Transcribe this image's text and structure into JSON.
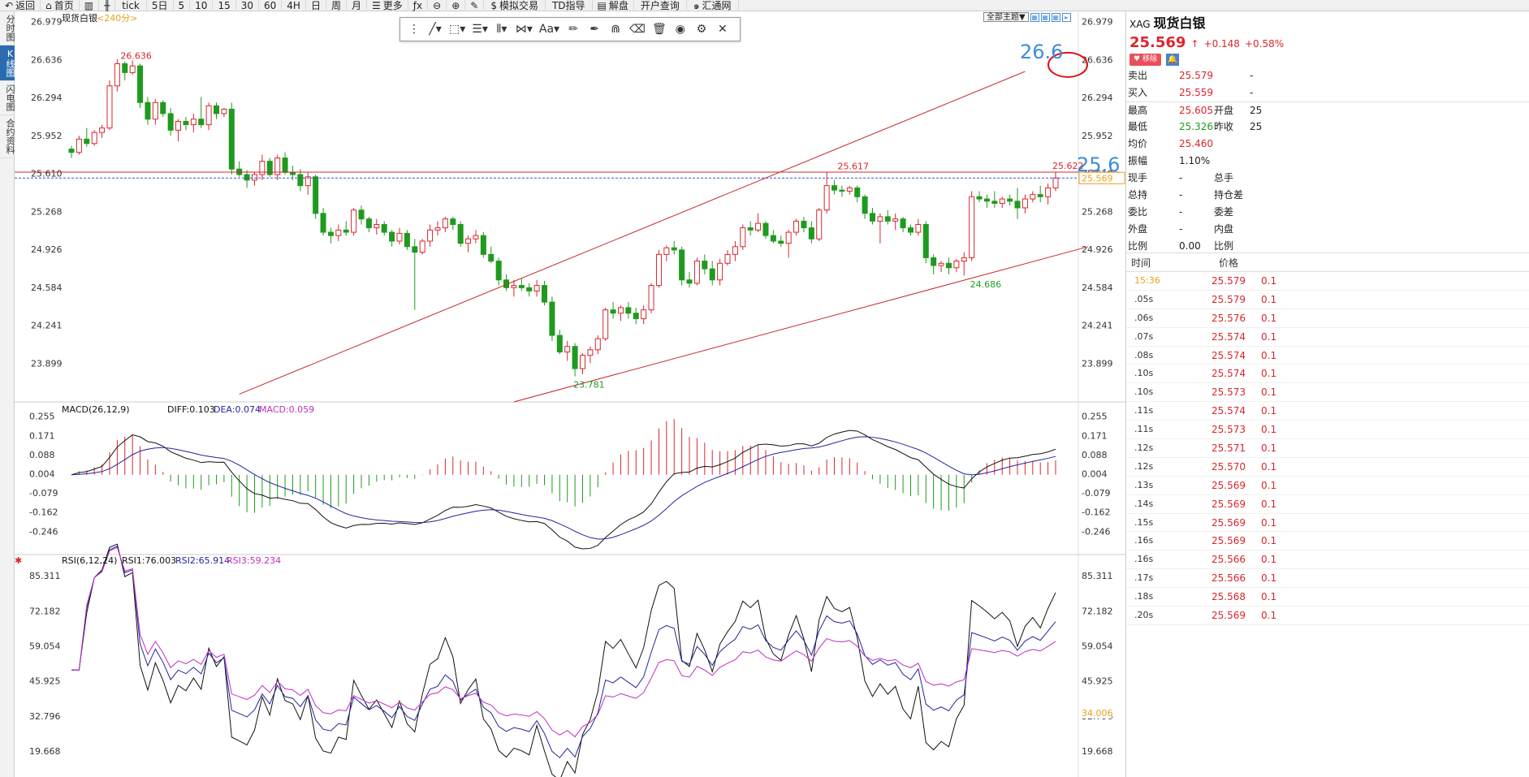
{
  "toolbar": [
    {
      "id": "back",
      "icon": "back-arrow-icon",
      "label": "返回"
    },
    {
      "id": "home",
      "icon": "home-icon",
      "label": "首页"
    },
    {
      "id": "chart-type",
      "icon": "bar-chart-icon",
      "label": ""
    },
    {
      "id": "candle-type",
      "icon": "candlestick-icon",
      "label": ""
    },
    {
      "id": "tick",
      "label": "tick"
    },
    {
      "id": "5d",
      "label": "5日"
    },
    {
      "id": "5m",
      "label": "5"
    },
    {
      "id": "10m",
      "label": "10"
    },
    {
      "id": "15m",
      "label": "15"
    },
    {
      "id": "30m",
      "label": "30"
    },
    {
      "id": "60m",
      "label": "60"
    },
    {
      "id": "4h",
      "label": "4H"
    },
    {
      "id": "day",
      "label": "日"
    },
    {
      "id": "week",
      "label": "周"
    },
    {
      "id": "month",
      "label": "月"
    },
    {
      "id": "more",
      "icon": "list-icon",
      "label": "更多"
    },
    {
      "id": "fx",
      "icon": "fx-icon",
      "label": ""
    },
    {
      "id": "zoom-out",
      "icon": "zoom-out-icon",
      "label": ""
    },
    {
      "id": "zoom-in",
      "icon": "zoom-in-icon",
      "label": ""
    },
    {
      "id": "draw",
      "icon": "pen-icon",
      "label": ""
    },
    {
      "id": "sim",
      "icon": "dollar-icon",
      "label": "模拟交易"
    },
    {
      "id": "td",
      "label": "TD指导"
    },
    {
      "id": "jiepan",
      "icon": "book-icon",
      "label": "解盘"
    },
    {
      "id": "account",
      "label": "开户查询"
    },
    {
      "id": "huitong",
      "icon": "swirl-icon",
      "label": "汇通网"
    }
  ],
  "left_tabs": [
    {
      "label": "分时图",
      "active": false
    },
    {
      "label": "K线图",
      "active": true
    },
    {
      "label": "闪电图",
      "active": false
    },
    {
      "label": "合约资料",
      "active": false
    }
  ],
  "draw_tools": [
    "line-tool-icon",
    "shape-tool-icon",
    "fib-tool-icon",
    "channel-tool-icon",
    "pattern-tool-icon",
    "text-tool-icon",
    "ruler-icon",
    "brush-icon",
    "magnet-icon",
    "eraser-icon",
    "trash-icon",
    "eye-icon",
    "settings-icon",
    "close-icon"
  ],
  "draw_tool_text": "Aa",
  "theme": {
    "label": "全部主题▼"
  },
  "chart": {
    "title": "现货白银",
    "period": "<240分>",
    "yticks": [
      "26.979",
      "26.636",
      "26.294",
      "25.952",
      "25.610",
      "25.268",
      "24.926",
      "24.584",
      "24.241",
      "23.899"
    ],
    "current_price": "25.569",
    "annotations": {
      "high": "26.636",
      "low": "23.781",
      "mid_high": "25.617",
      "right_high": "25.622",
      "right_low": "24.686"
    },
    "big_labels": {
      "upper": "26.6",
      "level": "25.6"
    },
    "candles": [
      [
        25.83,
        25.86,
        25.75,
        25.8
      ],
      [
        25.8,
        25.95,
        25.78,
        25.92
      ],
      [
        25.92,
        26.02,
        25.85,
        25.88
      ],
      [
        25.88,
        26.0,
        25.86,
        25.98
      ],
      [
        25.98,
        26.05,
        25.93,
        26.02
      ],
      [
        26.02,
        26.45,
        26.0,
        26.4
      ],
      [
        26.4,
        26.64,
        26.35,
        26.6
      ],
      [
        26.6,
        26.62,
        26.45,
        26.52
      ],
      [
        26.52,
        26.63,
        26.5,
        26.58
      ],
      [
        26.58,
        26.6,
        26.2,
        26.25
      ],
      [
        26.25,
        26.3,
        26.05,
        26.1
      ],
      [
        26.1,
        26.28,
        26.05,
        26.25
      ],
      [
        26.25,
        26.27,
        26.12,
        26.15
      ],
      [
        26.15,
        26.2,
        25.95,
        26.0
      ],
      [
        26.0,
        26.1,
        25.9,
        26.08
      ],
      [
        26.08,
        26.12,
        26.0,
        26.05
      ],
      [
        26.05,
        26.15,
        25.98,
        26.1
      ],
      [
        26.1,
        26.3,
        26.02,
        26.05
      ],
      [
        26.05,
        26.25,
        26.0,
        26.22
      ],
      [
        26.22,
        26.25,
        26.1,
        26.15
      ],
      [
        26.15,
        26.2,
        26.12,
        26.19
      ],
      [
        26.19,
        26.25,
        25.6,
        25.65
      ],
      [
        25.65,
        25.72,
        25.58,
        25.6
      ],
      [
        25.6,
        25.64,
        25.48,
        25.55
      ],
      [
        25.55,
        25.62,
        25.5,
        25.6
      ],
      [
        25.6,
        25.78,
        25.55,
        25.72
      ],
      [
        25.72,
        25.75,
        25.58,
        25.6
      ],
      [
        25.6,
        25.78,
        25.55,
        25.75
      ],
      [
        25.75,
        25.8,
        25.6,
        25.62
      ],
      [
        25.62,
        25.68,
        25.55,
        25.6
      ],
      [
        25.6,
        25.65,
        25.45,
        25.5
      ],
      [
        25.5,
        25.62,
        25.42,
        25.58
      ],
      [
        25.58,
        25.6,
        25.2,
        25.25
      ],
      [
        25.25,
        25.3,
        25.05,
        25.08
      ],
      [
        25.08,
        25.12,
        24.98,
        25.05
      ],
      [
        25.05,
        25.15,
        25.0,
        25.1
      ],
      [
        25.1,
        25.18,
        25.05,
        25.08
      ],
      [
        25.08,
        25.3,
        25.05,
        25.28
      ],
      [
        25.28,
        25.32,
        25.15,
        25.2
      ],
      [
        25.2,
        25.22,
        25.08,
        25.12
      ],
      [
        25.12,
        25.2,
        25.06,
        25.15
      ],
      [
        25.15,
        25.18,
        25.05,
        25.08
      ],
      [
        25.08,
        25.1,
        24.95,
        25.0
      ],
      [
        25.0,
        25.12,
        24.97,
        25.07
      ],
      [
        25.07,
        25.1,
        24.92,
        24.95
      ],
      [
        24.95,
        25.02,
        24.38,
        24.9
      ],
      [
        24.9,
        25.02,
        24.88,
        25.0
      ],
      [
        25.0,
        25.15,
        24.95,
        25.1
      ],
      [
        25.1,
        25.18,
        25.05,
        25.12
      ],
      [
        25.12,
        25.22,
        25.08,
        25.2
      ],
      [
        25.2,
        25.22,
        25.1,
        25.15
      ],
      [
        25.15,
        25.18,
        24.95,
        24.98
      ],
      [
        24.98,
        25.05,
        24.9,
        25.02
      ],
      [
        25.02,
        25.1,
        24.98,
        25.05
      ],
      [
        25.05,
        25.08,
        24.85,
        24.88
      ],
      [
        24.88,
        24.95,
        24.8,
        24.82
      ],
      [
        24.82,
        24.85,
        24.6,
        24.65
      ],
      [
        24.65,
        24.7,
        24.55,
        24.58
      ],
      [
        24.58,
        24.65,
        24.5,
        24.6
      ],
      [
        24.6,
        24.66,
        24.55,
        24.58
      ],
      [
        24.58,
        24.62,
        24.5,
        24.55
      ],
      [
        24.55,
        24.65,
        24.5,
        24.6
      ],
      [
        24.6,
        24.64,
        24.42,
        24.45
      ],
      [
        24.45,
        24.5,
        24.1,
        24.15
      ],
      [
        24.15,
        24.2,
        23.98,
        24.0
      ],
      [
        24.0,
        24.1,
        23.92,
        24.05
      ],
      [
        24.05,
        24.08,
        23.78,
        23.85
      ],
      [
        23.85,
        23.99,
        23.8,
        23.97
      ],
      [
        23.97,
        24.05,
        23.9,
        24.02
      ],
      [
        24.02,
        24.15,
        23.98,
        24.12
      ],
      [
        24.12,
        24.4,
        24.1,
        24.38
      ],
      [
        24.38,
        24.45,
        24.3,
        24.35
      ],
      [
        24.35,
        24.42,
        24.28,
        24.4
      ],
      [
        24.4,
        24.45,
        24.3,
        24.35
      ],
      [
        24.35,
        24.4,
        24.25,
        24.3
      ],
      [
        24.3,
        24.42,
        24.25,
        24.38
      ],
      [
        24.38,
        24.62,
        24.35,
        24.6
      ],
      [
        24.6,
        24.92,
        24.58,
        24.88
      ],
      [
        24.88,
        24.96,
        24.82,
        24.94
      ],
      [
        24.94,
        25.0,
        24.88,
        24.92
      ],
      [
        24.92,
        24.95,
        24.6,
        24.65
      ],
      [
        24.65,
        24.72,
        24.58,
        24.62
      ],
      [
        24.62,
        24.85,
        24.6,
        24.82
      ],
      [
        24.82,
        24.88,
        24.7,
        24.75
      ],
      [
        24.75,
        24.82,
        24.6,
        24.65
      ],
      [
        24.65,
        24.84,
        24.6,
        24.8
      ],
      [
        24.8,
        24.92,
        24.78,
        24.88
      ],
      [
        24.88,
        25.0,
        24.82,
        24.95
      ],
      [
        24.95,
        25.15,
        24.92,
        25.12
      ],
      [
        25.12,
        25.18,
        25.05,
        25.1
      ],
      [
        25.1,
        25.25,
        25.08,
        25.16
      ],
      [
        25.16,
        25.18,
        25.02,
        25.05
      ],
      [
        25.05,
        25.1,
        24.98,
        25.0
      ],
      [
        25.0,
        25.05,
        24.95,
        24.98
      ],
      [
        24.98,
        25.1,
        24.85,
        25.08
      ],
      [
        25.08,
        25.2,
        25.05,
        25.18
      ],
      [
        25.18,
        25.22,
        25.08,
        25.12
      ],
      [
        25.12,
        25.18,
        24.98,
        25.02
      ],
      [
        25.02,
        25.3,
        25.0,
        25.28
      ],
      [
        25.28,
        25.62,
        25.25,
        25.5
      ],
      [
        25.5,
        25.55,
        25.42,
        25.46
      ],
      [
        25.46,
        25.5,
        25.4,
        25.45
      ],
      [
        25.45,
        25.5,
        25.42,
        25.48
      ],
      [
        25.48,
        25.5,
        25.35,
        25.4
      ],
      [
        25.4,
        25.42,
        25.2,
        25.25
      ],
      [
        25.25,
        25.3,
        25.15,
        25.18
      ],
      [
        25.18,
        25.25,
        24.98,
        25.22
      ],
      [
        25.22,
        25.28,
        25.15,
        25.18
      ],
      [
        25.18,
        25.25,
        25.1,
        25.2
      ],
      [
        25.2,
        25.22,
        25.08,
        25.12
      ],
      [
        25.12,
        25.15,
        25.05,
        25.08
      ],
      [
        25.08,
        25.2,
        25.05,
        25.15
      ],
      [
        25.15,
        25.18,
        24.8,
        24.85
      ],
      [
        24.85,
        24.88,
        24.7,
        24.78
      ],
      [
        24.78,
        24.82,
        24.72,
        24.8
      ],
      [
        24.8,
        24.85,
        24.7,
        24.76
      ],
      [
        24.76,
        24.84,
        24.72,
        24.82
      ],
      [
        24.82,
        24.9,
        24.69,
        24.85
      ],
      [
        24.85,
        25.45,
        24.82,
        25.4
      ],
      [
        25.4,
        25.45,
        25.35,
        25.38
      ],
      [
        25.38,
        25.42,
        25.3,
        25.36
      ],
      [
        25.36,
        25.45,
        25.3,
        25.34
      ],
      [
        25.34,
        25.4,
        25.3,
        25.38
      ],
      [
        25.38,
        25.42,
        25.32,
        25.36
      ],
      [
        25.36,
        25.48,
        25.2,
        25.3
      ],
      [
        25.3,
        25.42,
        25.25,
        25.38
      ],
      [
        25.38,
        25.45,
        25.35,
        25.42
      ],
      [
        25.42,
        25.5,
        25.35,
        25.4
      ],
      [
        25.4,
        25.52,
        25.33,
        25.48
      ],
      [
        25.48,
        25.62,
        25.45,
        25.57
      ]
    ],
    "macd": {
      "label": "MACD(26,12,9)",
      "diff": "DIFF:0.103",
      "dea": "DEA:0.074",
      "macd": "MACD:0.059",
      "yticks": [
        "0.255",
        "0.171",
        "0.088",
        "0.004",
        "-0.079",
        "-0.162",
        "-0.246"
      ]
    },
    "rsi": {
      "label": "RSI(6,12,24)",
      "rsi1": "RSI1:76.003",
      "rsi2": "RSI2:65.914",
      "rsi3": "RSI3:59.234",
      "yticks": [
        "85.311",
        "72.182",
        "59.054",
        "45.925",
        "32.796",
        "19.668"
      ],
      "current": "34.006"
    }
  },
  "colors": {
    "up": "#d9262c",
    "down": "#1f9a1f",
    "diff": "#111111",
    "dea": "#23239e",
    "macd": "#c02ec0",
    "trend": "#c8282d",
    "accent": "#3b8ddb",
    "current": "#e8a020"
  },
  "panel": {
    "code": "XAG",
    "name": "现货白银",
    "price": "25.569",
    "arrow": "↑",
    "change": "+0.148",
    "pct": "+0.58%",
    "remove_label": "移除",
    "rows": [
      {
        "k": "卖出",
        "v": "25.579",
        "k2": "",
        "v2": "-"
      },
      {
        "k": "买入",
        "v": "25.559",
        "k2": "",
        "v2": "-"
      },
      {
        "k": "最高",
        "v": "25.605",
        "k2": "开盘",
        "v2": "25"
      },
      {
        "k": "最低",
        "v": "25.326",
        "k2": "昨收",
        "v2": "25"
      },
      {
        "k": "均价",
        "v": "25.460",
        "k2": "",
        "v2": ""
      },
      {
        "k": "振幅",
        "v": "1.10%",
        "k2": "",
        "v2": ""
      },
      {
        "k": "现手",
        "v": "-",
        "k2": "总手",
        "v2": ""
      },
      {
        "k": "总持",
        "v": "-",
        "k2": "持仓差",
        "v2": ""
      },
      {
        "k": "委比",
        "v": "-",
        "k2": "委差",
        "v2": ""
      },
      {
        "k": "外盘",
        "v": "-",
        "k2": "内盘",
        "v2": ""
      },
      {
        "k": "比例",
        "v": "0.00",
        "k2": "比例",
        "v2": ""
      }
    ],
    "tick_header": {
      "time": "时间",
      "price": "价格"
    },
    "ticks": [
      {
        "t": "15:36",
        "p": "25.579",
        "q": "0.1"
      },
      {
        "t": ".05s",
        "p": "25.579",
        "q": "0.1"
      },
      {
        "t": ".06s",
        "p": "25.576",
        "q": "0.1"
      },
      {
        "t": ".07s",
        "p": "25.574",
        "q": "0.1"
      },
      {
        "t": ".08s",
        "p": "25.574",
        "q": "0.1"
      },
      {
        "t": ".10s",
        "p": "25.574",
        "q": "0.1"
      },
      {
        "t": ".10s",
        "p": "25.573",
        "q": "0.1"
      },
      {
        "t": ".11s",
        "p": "25.574",
        "q": "0.1"
      },
      {
        "t": ".11s",
        "p": "25.573",
        "q": "0.1"
      },
      {
        "t": ".12s",
        "p": "25.571",
        "q": "0.1"
      },
      {
        "t": ".12s",
        "p": "25.570",
        "q": "0.1"
      },
      {
        "t": ".13s",
        "p": "25.569",
        "q": "0.1"
      },
      {
        "t": ".14s",
        "p": "25.569",
        "q": "0.1"
      },
      {
        "t": ".15s",
        "p": "25.569",
        "q": "0.1"
      },
      {
        "t": ".16s",
        "p": "25.569",
        "q": "0.1"
      },
      {
        "t": ".16s",
        "p": "25.566",
        "q": "0.1"
      },
      {
        "t": ".17s",
        "p": "25.566",
        "q": "0.1"
      },
      {
        "t": ".18s",
        "p": "25.568",
        "q": "0.1"
      },
      {
        "t": ".20s",
        "p": "25.569",
        "q": "0.1"
      }
    ]
  }
}
